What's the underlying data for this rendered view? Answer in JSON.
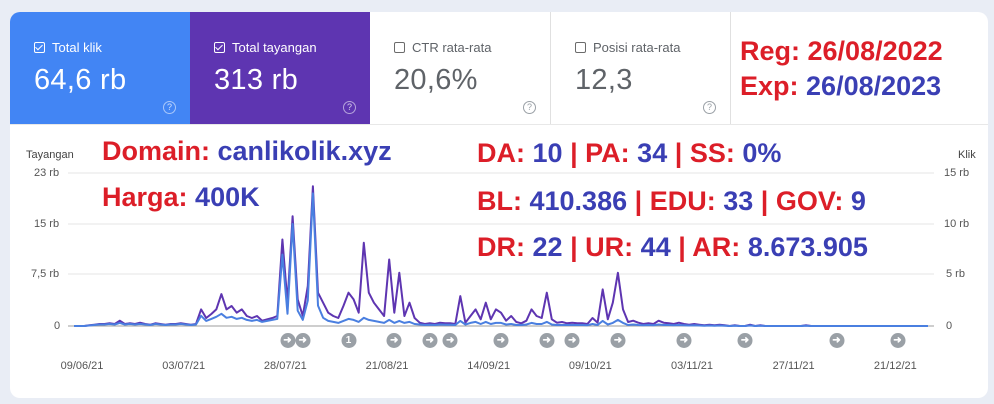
{
  "metrics": [
    {
      "label": "Total klik",
      "value": "64,6 rb",
      "checked": true,
      "color": "#4285f4"
    },
    {
      "label": "Total tayangan",
      "value": "313 rb",
      "checked": true,
      "color": "#5e35b1"
    },
    {
      "label": "CTR rata-rata",
      "value": "20,6%",
      "checked": false
    },
    {
      "label": "Posisi rata-rata",
      "value": "12,3",
      "checked": false
    }
  ],
  "help_glyph": "?",
  "overlay": {
    "reg_label": "Reg:",
    "reg_value": "26/08/2022",
    "exp_label": "Exp:",
    "exp_value": "26/08/2023",
    "domain_label": "Domain:",
    "domain_value": "canlikolik.xyz",
    "harga_label": "Harga:",
    "harga_value": "400K",
    "da_label": "DA:",
    "da_value": "10",
    "pa_label": "PA:",
    "pa_value": "34",
    "ss_label": "SS:",
    "ss_value": "0%",
    "bl_label": "BL:",
    "bl_value": "410.386",
    "edu_label": "EDU:",
    "edu_value": "33",
    "gov_label": "GOV:",
    "gov_value": "9",
    "dr_label": "DR:",
    "dr_value": "22",
    "ur_label": "UR:",
    "ur_value": "44",
    "ar_label": "AR:",
    "ar_value": "8.673.905",
    "sep": "|"
  },
  "chart_data": {
    "type": "line",
    "left_axis_title": "Tayangan",
    "right_axis_title": "Klik",
    "left_ticks": [
      "23 rb",
      "15 rb",
      "7,5 rb",
      "0"
    ],
    "right_ticks": [
      "15 rb",
      "10 rb",
      "5 rb",
      "0"
    ],
    "left_ylim": [
      0,
      23000
    ],
    "right_ylim": [
      0,
      15000
    ],
    "x_ticks": [
      "09/06/21",
      "03/07/21",
      "28/07/21",
      "21/08/21",
      "14/09/21",
      "09/10/21",
      "03/11/21",
      "27/11/21",
      "21/12/21"
    ],
    "annotation_markers": [
      {
        "x_index": 42,
        "glyph": "➜"
      },
      {
        "x_index": 45,
        "glyph": "➜"
      },
      {
        "x_index": 54,
        "glyph": "1"
      },
      {
        "x_index": 63,
        "glyph": "➜"
      },
      {
        "x_index": 70,
        "glyph": "➜"
      },
      {
        "x_index": 74,
        "glyph": "➜"
      },
      {
        "x_index": 84,
        "glyph": "➜"
      },
      {
        "x_index": 93,
        "glyph": "➜"
      },
      {
        "x_index": 98,
        "glyph": "➜"
      },
      {
        "x_index": 107,
        "glyph": "➜"
      },
      {
        "x_index": 120,
        "glyph": "➜"
      },
      {
        "x_index": 132,
        "glyph": "➜"
      },
      {
        "x_index": 150,
        "glyph": "➜"
      },
      {
        "x_index": 162,
        "glyph": "➜"
      }
    ],
    "series": [
      {
        "name": "Total tayangan",
        "axis": "left",
        "color": "#5e35b1",
        "values": [
          0,
          0,
          0,
          100,
          200,
          300,
          300,
          400,
          300,
          800,
          300,
          400,
          300,
          500,
          300,
          200,
          400,
          300,
          200,
          300,
          300,
          400,
          300,
          200,
          300,
          2500,
          1200,
          1800,
          2500,
          4800,
          2500,
          3000,
          2000,
          2500,
          1500,
          1200,
          1500,
          800,
          1000,
          1200,
          1500,
          13000,
          3500,
          16500,
          4000,
          1500,
          6000,
          21000,
          5000,
          3500,
          2000,
          1500,
          1200,
          3000,
          5000,
          4000,
          2000,
          12500,
          5000,
          3500,
          2500,
          1500,
          10000,
          2000,
          8000,
          1500,
          3500,
          1200,
          500,
          300,
          400,
          300,
          500,
          400,
          400,
          300,
          4500,
          500,
          1500,
          2500,
          1000,
          3500,
          1000,
          2500,
          2000,
          800,
          1500,
          600,
          400,
          800,
          2500,
          1500,
          1200,
          5000,
          1000,
          500,
          600,
          400,
          500,
          400,
          400,
          300,
          1200,
          500,
          5500,
          1000,
          3500,
          8000,
          2500,
          600,
          800,
          500,
          300,
          400,
          300,
          800,
          500,
          400,
          300,
          500,
          300,
          200,
          300,
          200,
          100,
          200,
          100,
          200,
          100,
          0,
          100,
          0,
          0,
          200,
          0,
          100,
          0,
          0,
          0,
          0,
          0,
          0,
          0,
          0,
          100,
          0,
          0,
          0,
          0,
          0,
          0,
          0,
          0,
          0,
          0,
          0,
          0,
          0,
          0,
          0,
          0,
          0,
          0,
          0,
          0,
          0,
          0,
          0,
          0
        ]
      },
      {
        "name": "Total klik",
        "axis": "right",
        "color": "#4a7fe0",
        "values": [
          0,
          0,
          0,
          50,
          100,
          150,
          150,
          200,
          150,
          300,
          150,
          200,
          150,
          200,
          150,
          100,
          200,
          150,
          100,
          150,
          150,
          200,
          150,
          100,
          150,
          1000,
          500,
          700,
          900,
          1200,
          800,
          900,
          700,
          800,
          600,
          500,
          600,
          400,
          500,
          600,
          700,
          7000,
          1200,
          10000,
          1500,
          600,
          2500,
          13000,
          2000,
          800,
          500,
          400,
          300,
          500,
          700,
          600,
          400,
          800,
          600,
          500,
          400,
          300,
          600,
          300,
          500,
          300,
          400,
          200,
          150,
          100,
          120,
          100,
          150,
          120,
          120,
          100,
          500,
          150,
          300,
          400,
          200,
          400,
          200,
          300,
          300,
          150,
          200,
          100,
          100,
          150,
          300,
          200,
          200,
          400,
          150,
          100,
          100,
          100,
          100,
          100,
          100,
          80,
          200,
          100,
          500,
          150,
          300,
          600,
          300,
          100,
          150,
          100,
          80,
          100,
          80,
          150,
          100,
          100,
          80,
          100,
          80,
          50,
          80,
          50,
          30,
          50,
          30,
          50,
          30,
          0,
          30,
          0,
          0,
          50,
          0,
          30,
          0,
          0,
          0,
          0,
          0,
          0,
          0,
          0,
          30,
          0,
          0,
          0,
          0,
          0,
          0,
          0,
          0,
          0,
          0,
          0,
          0,
          0,
          0,
          0,
          0,
          0,
          0,
          0,
          0,
          0,
          0,
          0,
          0
        ]
      }
    ]
  }
}
